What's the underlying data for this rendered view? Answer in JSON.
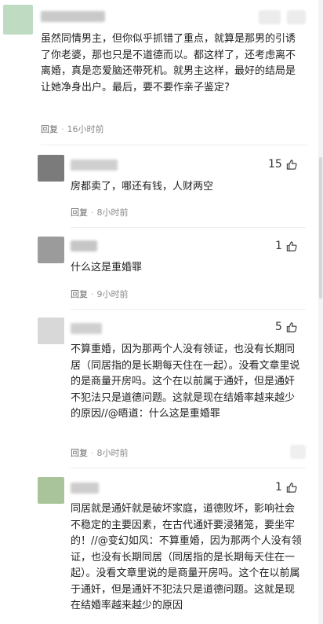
{
  "colors": {
    "text": "#222222",
    "meta": "#8a8a8a",
    "divider": "#eeeeee"
  },
  "comments": [
    {
      "text": "虽然同情男主，但你似乎抓错了重点，就算是那男的引诱了你老婆，那也只是不道德而以。都这样了，还考虑离不离婚，真是恋爱脑还带死机。就男主这样，最好的结局是让她净身出户。最后，要不要作亲子鉴定?",
      "reply_label": "回复",
      "time": "16小时前"
    },
    {
      "text": "房都卖了，哪还有钱，人财两空",
      "reply_label": "回复",
      "time": "8小时前",
      "likes": "15"
    },
    {
      "text": "什么这是重婚罪",
      "reply_label": "回复",
      "time": "9小时前",
      "likes": "1"
    },
    {
      "text": "不算重婚，因为那两个人没有领证，也没有长期同居（同居指的是长期每天住在一起）。没看文章里说的是商量开房吗。这个在以前属于通奸，但是通奸不犯法只是道德问题。这就是现在结婚率越来越少的原因//@晤道：什么这是重婚罪",
      "reply_label": "回复",
      "time": "8小时前",
      "likes": "5"
    },
    {
      "text": "同居就是通奸就是破坏家庭，道德败坏，影响社会不稳定的主要因素，在古代通奸要浸猪笼，要坐牢的！//@变幻如风：不算重婚，因为那两个人没有领证，也没有长期同居（同居指的是长期每天住在一起）。没看文章里说的是商量开房吗。这个在以前属于通奸，但是通奸不犯法只是道德问题。这就是现在结婚率越来越少的原因",
      "likes": "1"
    }
  ]
}
